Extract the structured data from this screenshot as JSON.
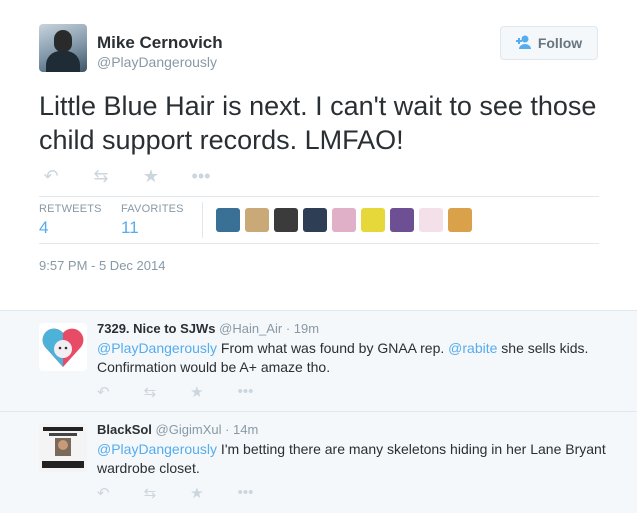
{
  "tweet": {
    "author_name": "Mike Cernovich",
    "author_handle": "@PlayDangerously",
    "follow_label": "Follow",
    "text": "Little Blue Hair is next. I can't wait to see those child support records. LMFAO!",
    "stats": {
      "retweets_label": "RETWEETS",
      "retweets_count": "4",
      "favorites_label": "FAVORITES",
      "favorites_count": "11"
    },
    "timestamp": "9:57 PM - 5 Dec 2014",
    "favoriters_colors": [
      "#3a6f96",
      "#caa978",
      "#3b3b3b",
      "#2e3e55",
      "#e0b0c8",
      "#e6d83a",
      "#6d4f94",
      "#f4e0e8",
      "#d9a24a"
    ]
  },
  "replies": [
    {
      "name": "7329. Nice to SJWs",
      "handle": "@Hain_Air",
      "time": "· 19m",
      "mention1": "@PlayDangerously",
      "text1": " From what was found by GNAA rep. ",
      "mention2": "@rabite",
      "text2": " she sells kids. Confirmation would be A+ amaze tho."
    },
    {
      "name": "BlackSol",
      "handle": "@GigimXul",
      "time": "· 14m",
      "mention1": "@PlayDangerously",
      "text1": " I'm betting there are many skeletons hiding in her Lane Bryant wardrobe closet."
    }
  ],
  "icons": [
    "reply-icon",
    "retweet-icon",
    "favorite-icon",
    "more-icon",
    "follow-user-icon"
  ],
  "colors": {
    "accent": "#55acee",
    "muted": "#8899a6",
    "text": "#292f33"
  }
}
